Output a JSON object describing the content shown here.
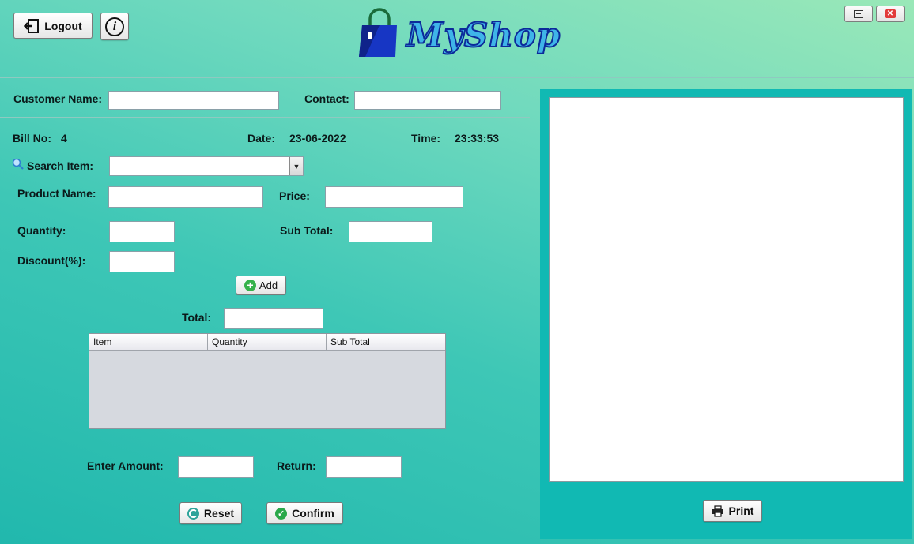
{
  "header": {
    "logout_label": "Logout",
    "brand": "MyShop",
    "info_icon_text": "i"
  },
  "customer": {
    "name_label": "Customer Name:",
    "name_value": "",
    "contact_label": "Contact:",
    "contact_value": ""
  },
  "bill": {
    "bill_no_label": "Bill No:",
    "bill_no": "4",
    "date_label": "Date:",
    "date": "23-06-2022",
    "time_label": "Time:",
    "time": "23:33:53"
  },
  "product": {
    "search_label": "Search Item:",
    "search_value": "",
    "name_label": "Product Name:",
    "name_value": "",
    "price_label": "Price:",
    "price_value": "",
    "quantity_label": "Quantity:",
    "quantity_value": "",
    "subtotal_label": "Sub Total:",
    "subtotal_value": "",
    "discount_label": "Discount(%):",
    "discount_value": "",
    "add_label": "Add"
  },
  "total": {
    "label": "Total:",
    "value": ""
  },
  "table": {
    "columns": [
      "Item",
      "Quantity",
      "Sub Total"
    ],
    "rows": []
  },
  "payment": {
    "amount_label": "Enter Amount:",
    "amount_value": "",
    "return_label": "Return:",
    "return_value": ""
  },
  "actions": {
    "reset_label": "Reset",
    "confirm_label": "Confirm",
    "print_label": "Print"
  },
  "colors": {
    "accent": "#11b9b3",
    "brand_blue": "#1a3cc8"
  }
}
